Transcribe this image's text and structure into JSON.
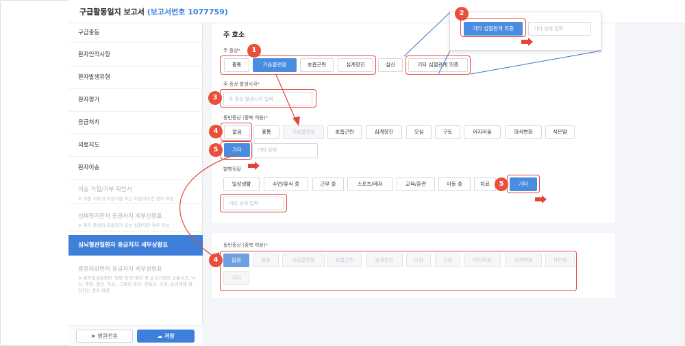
{
  "header": {
    "title": "구급활동일지 보고서",
    "report_no": "(보고서번호 1077759)"
  },
  "sidebar": {
    "items": [
      {
        "label": "구급출동"
      },
      {
        "label": "환자인적사항"
      },
      {
        "label": "환자발생유형"
      },
      {
        "label": "환자평가"
      },
      {
        "label": "응급처치"
      },
      {
        "label": "의료지도"
      },
      {
        "label": "환자이송"
      },
      {
        "label": "이송 거절/거부 확인서",
        "sub": "※ 이송 사유가 이송거절 또는 이송거부인 경우 작성"
      },
      {
        "label": "심폐정지환자 응급처치 세부상황표",
        "sub": "※ 환자 증상이 호흡정지 또는 심정지인 경우 작성"
      },
      {
        "label": "심뇌혈관질환자 응급처치 세부상황표"
      },
      {
        "label": "중증외상환자 응급처치 세부상황표",
        "sub": "※ 환자발생유형이 '질병 외'인 환자 중 손상기전이 교통사고, 낙상, 추락, 열상, 자상 , 그밖의 둔상, 관통상, 기계, 농기계에 해당하는 경우 작성"
      }
    ],
    "send_button": "병원전송",
    "save_button": "저장"
  },
  "main": {
    "section_title": "주 호소",
    "chief_label": "주 증상",
    "chief_options": [
      "흉통",
      "가슴불편함",
      "호흡곤란",
      "심계항진",
      "실신",
      "기타 심혈관계 의증"
    ],
    "chief_selected": "가슴불편함",
    "onset_label": "주 증상 발생시각",
    "onset_placeholder": "주 증상 발생시각 입력",
    "accomp_label": "동반증상 (중복 허용)",
    "accomp_options": [
      "없음",
      "흉통",
      "가슴불편함",
      "호흡곤란",
      "심계항진",
      "오심",
      "구토",
      "어지러움",
      "의식변화",
      "식은땀"
    ],
    "accomp_other": "기타",
    "accomp_other_placeholder": "기타 상세",
    "situation_label": "발병정황",
    "situation_options": [
      "일상생활",
      "수면/휴식 중",
      "근무 중",
      "스포츠/레저",
      "교육/훈련",
      "이동 중",
      "치료",
      "기타"
    ],
    "situation_other_placeholder": "기타 상세 입력",
    "accomp2_label": "동반증상 (중복 허용)",
    "accomp2_options": [
      "없음",
      "흉통",
      "가슴불편함",
      "호흡곤란",
      "심계항진",
      "오심",
      "구토",
      "어지러움",
      "의식변화",
      "식은땀",
      "기타"
    ]
  },
  "popup": {
    "button": "기타 심혈관계 의증",
    "placeholder": "기타 상세 입력"
  },
  "badges": [
    "1",
    "2",
    "3",
    "4",
    "5",
    "4",
    "5"
  ],
  "colors": {
    "accent": "#4a8de0",
    "highlight": "#e0463c",
    "badge": "#e8503a"
  }
}
